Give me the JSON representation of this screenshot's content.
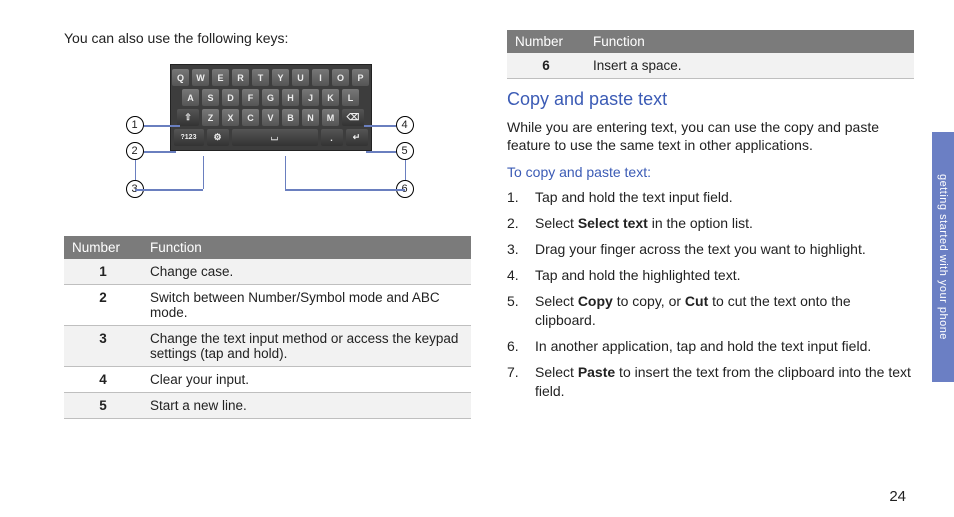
{
  "left": {
    "intro": "You can also use the following keys:",
    "keyboard": {
      "row1": [
        "Q",
        "W",
        "E",
        "R",
        "T",
        "Y",
        "U",
        "I",
        "O",
        "P"
      ],
      "row2": [
        "A",
        "S",
        "D",
        "F",
        "G",
        "H",
        "J",
        "K",
        "L"
      ],
      "row3_shift": "⇧",
      "row3": [
        "Z",
        "X",
        "C",
        "V",
        "B",
        "N",
        "M"
      ],
      "row3_bksp": "⌫",
      "row4_mode": "?123",
      "row4_gear": "⚙",
      "row4_space": "⌴",
      "row4_dot": ".",
      "row4_enter": "↵"
    },
    "callouts": {
      "c1": "1",
      "c2": "2",
      "c3": "3",
      "c4": "4",
      "c5": "5",
      "c6": "6"
    },
    "table": {
      "head_num": "Number",
      "head_fn": "Function",
      "rows": [
        {
          "n": "1",
          "f": "Change case."
        },
        {
          "n": "2",
          "f": "Switch between Number/Symbol mode and ABC mode."
        },
        {
          "n": "3",
          "f": "Change the text input method or access the keypad settings (tap and hold)."
        },
        {
          "n": "4",
          "f": "Clear your input."
        },
        {
          "n": "5",
          "f": "Start a new line."
        }
      ]
    }
  },
  "right": {
    "table": {
      "head_num": "Number",
      "head_fn": "Function",
      "rows": [
        {
          "n": "6",
          "f": "Insert a space."
        }
      ]
    },
    "section_title": "Copy and paste text",
    "section_body": "While you are entering text, you can use the copy and paste feature to use the same text in other applications.",
    "sub_heading": "To copy and paste text:",
    "steps": [
      {
        "n": "1.",
        "pre": "Tap and hold the text input field.",
        "b": "",
        "post": ""
      },
      {
        "n": "2.",
        "pre": "Select ",
        "b": "Select text",
        "post": " in the option list."
      },
      {
        "n": "3.",
        "pre": "Drag your finger across the text you want to highlight.",
        "b": "",
        "post": ""
      },
      {
        "n": "4.",
        "pre": "Tap and hold the highlighted text.",
        "b": "",
        "post": ""
      },
      {
        "n": "5.",
        "pre": "Select ",
        "b": "Copy",
        "mid": " to copy, or ",
        "b2": "Cut",
        "post": " to cut the text onto the clipboard."
      },
      {
        "n": "6.",
        "pre": "In another application, tap and hold the text input field.",
        "b": "",
        "post": ""
      },
      {
        "n": "7.",
        "pre": "Select ",
        "b": "Paste",
        "post": " to insert the text from the clipboard into the text field."
      }
    ]
  },
  "side_tab": "getting started with your phone",
  "page_number": "24"
}
